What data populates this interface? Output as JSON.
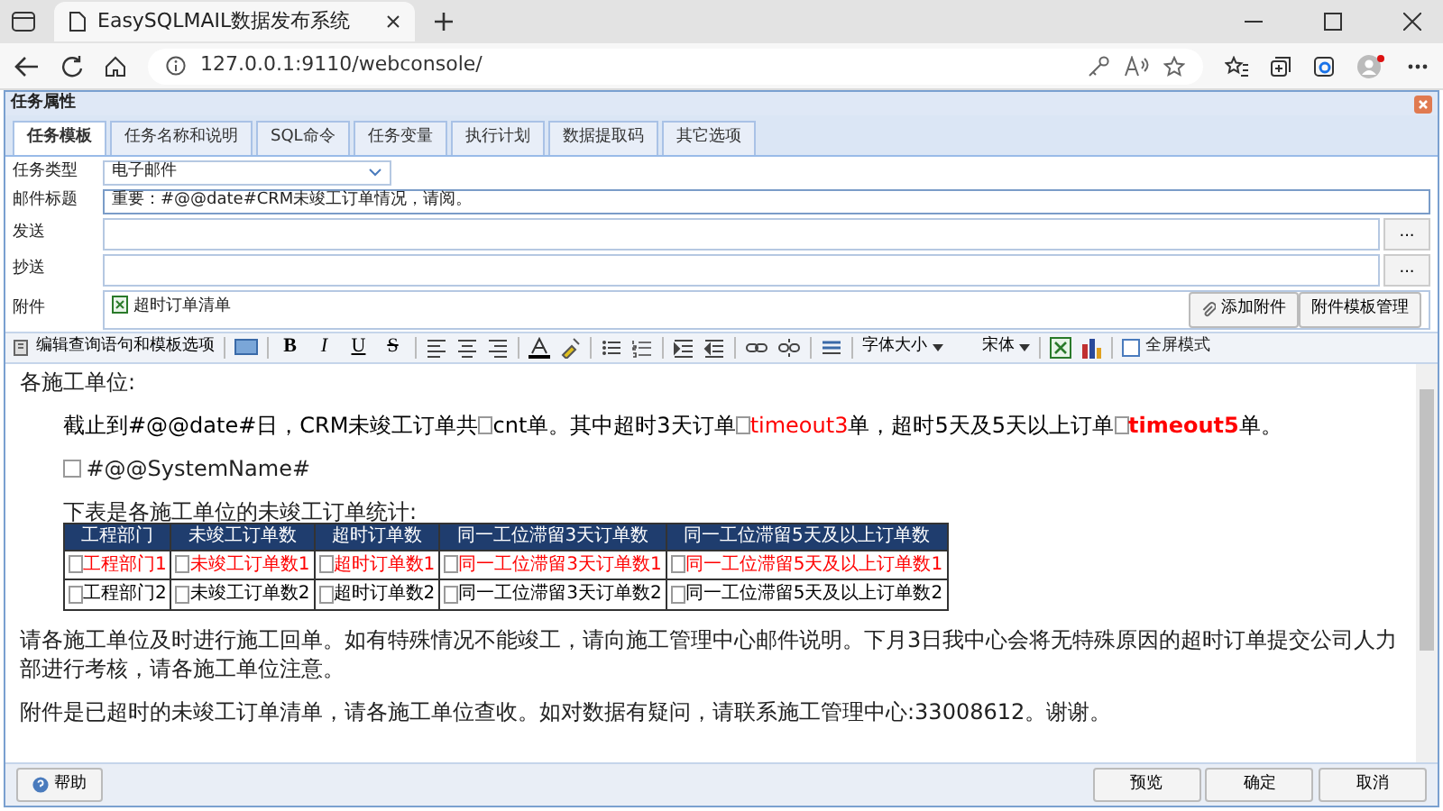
{
  "browser": {
    "tab_title": "EasySQLMAIL数据发布系统",
    "url": "127.0.0.1:9110/webconsole/"
  },
  "dialog": {
    "title": "任务属性",
    "tabs": [
      {
        "label": "任务模板",
        "selected": true
      },
      {
        "label": "任务名称和说明",
        "selected": false
      },
      {
        "label": "SQL命令",
        "selected": false
      },
      {
        "label": "任务变量",
        "selected": false
      },
      {
        "label": "执行计划",
        "selected": false
      },
      {
        "label": "数据提取码",
        "selected": false
      },
      {
        "label": "其它选项",
        "selected": false
      }
    ],
    "form": {
      "task_type": {
        "label": "任务类型",
        "value": "电子邮件"
      },
      "subject": {
        "label": "邮件标题",
        "value": "重要：#@@date#CRM未竣工订单情况，请阅。"
      },
      "to": {
        "label": "发送",
        "button": "..."
      },
      "cc": {
        "label": "抄送",
        "button": "..."
      },
      "attachments": {
        "label": "附件",
        "files": [
          "超时订单清单"
        ],
        "add_button": "添加附件",
        "manage_button": "附件模板管理"
      }
    },
    "toolbar": {
      "edit_query": "编辑查询语句和模板选项",
      "bold": "B",
      "italic": "I",
      "underline": "U",
      "strike": "S",
      "font_size": "字体大小",
      "font": "宋体",
      "fullscreen": {
        "label": "全屏模式",
        "checked": false
      }
    },
    "editor": {
      "greeting": "各施工单位:",
      "summary": [
        {
          "kind": "text",
          "text": "截止到#@@date#日，CRM未竣工订单共",
          "color": "#000000",
          "bold": false
        },
        {
          "kind": "image",
          "text": "cnt",
          "color": "#000000",
          "bold": false
        },
        {
          "kind": "text",
          "text": "单。其中超时3天订单",
          "color": "#000000",
          "bold": false
        },
        {
          "kind": "image",
          "text": "timeout3",
          "color": "#ff0000",
          "bold": false
        },
        {
          "kind": "text",
          "text": "单，超时5天及5天以上订单",
          "color": "#000000",
          "bold": false
        },
        {
          "kind": "image",
          "text": "timeout5",
          "color": "#ff0000",
          "bold": true
        },
        {
          "kind": "text",
          "text": "单。",
          "color": "#000000",
          "bold": false
        }
      ],
      "system_name": "#@@SystemName#",
      "table_intro": "下表是各施工单位的未竣工订单统计:",
      "table": {
        "columns": [
          "工程部门",
          "未竣工订单数",
          "超时订单数",
          "同一工位滞留3天订单数",
          "同一工位滞留5天及以上订单数"
        ],
        "rows": [
          {
            "color": "#ff0000",
            "cells": [
              "工程部门1",
              "未竣工订单数1",
              "超时订单数1",
              "同一工位滞留3天订单数1",
              "同一工位滞留5天及以上订单数1"
            ]
          },
          {
            "color": "#000000",
            "cells": [
              "工程部门2",
              "未竣工订单数2",
              "超时订单数2",
              "同一工位滞留3天订单数2",
              "同一工位滞留5天及以上订单数2"
            ]
          }
        ]
      },
      "paragraphs": [
        "请各施工单位及时进行施工回单。如有特殊情况不能竣工，请向施工管理中心邮件说明。下月3日我中心会将无特殊原因的超时订单提交公司人力部进行考核，请各施工单位注意。",
        "附件是已超时的未竣工订单清单，请各施工单位查收。如对数据有疑问，请联系施工管理中心:33008612。谢谢。"
      ]
    },
    "footer": {
      "help": "帮助",
      "buttons": [
        "预览",
        "确定",
        "取消"
      ]
    }
  }
}
